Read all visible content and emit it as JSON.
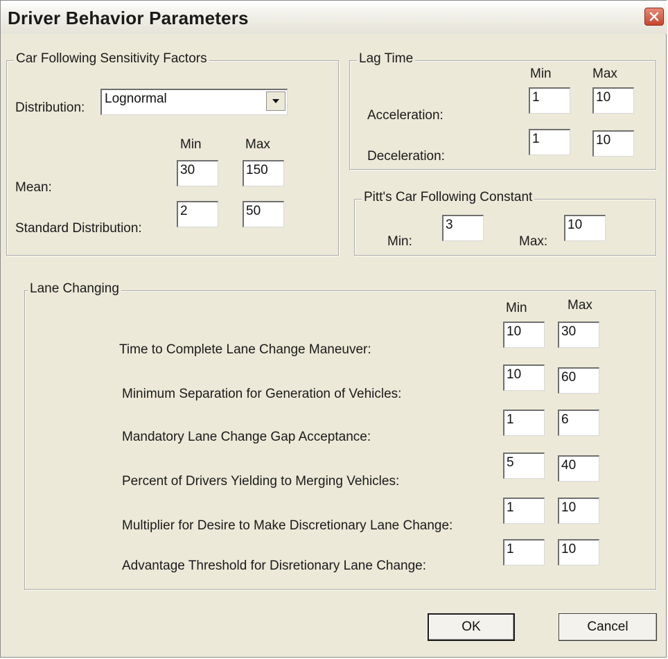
{
  "window": {
    "title": "Driver Behavior Parameters",
    "close_icon": "close-icon",
    "accent_color": "#c9452e"
  },
  "car_following": {
    "legend": "Car Following Sensitivity Factors",
    "distribution_label": "Distribution:",
    "distribution_value": "Lognormal",
    "min_header": "Min",
    "max_header": "Max",
    "mean_label": "Mean:",
    "mean_min": "30",
    "mean_max": "150",
    "std_label": "Standard Distribution:",
    "std_min": "2",
    "std_max": "50"
  },
  "lag_time": {
    "legend": "Lag Time",
    "min_header": "Min",
    "max_header": "Max",
    "accel_label": "Acceleration:",
    "accel_min": "1",
    "accel_max": "10",
    "decel_label": "Deceleration:",
    "decel_min": "1",
    "decel_max": "10"
  },
  "pitt": {
    "legend": "Pitt's Car Following Constant",
    "min_label": "Min:",
    "min_value": "3",
    "max_label": "Max:",
    "max_value": "10"
  },
  "lane_changing": {
    "legend": "Lane Changing",
    "min_header": "Min",
    "max_header": "Max",
    "rows": [
      {
        "label": "Time to Complete Lane Change Maneuver:",
        "min": "10",
        "max": "30"
      },
      {
        "label": "Minimum Separation for Generation of Vehicles:",
        "min": "10",
        "max": "60"
      },
      {
        "label": "Mandatory Lane Change Gap Acceptance:",
        "min": "1",
        "max": "6"
      },
      {
        "label": "Percent of Drivers Yielding to Merging Vehicles:",
        "min": "5",
        "max": "40"
      },
      {
        "label": "Multiplier for Desire to Make Discretionary Lane Change:",
        "min": "1",
        "max": "10"
      },
      {
        "label": "Advantage Threshold for Disretionary Lane Change:",
        "min": "1",
        "max": "10"
      }
    ]
  },
  "buttons": {
    "ok": "OK",
    "cancel": "Cancel"
  }
}
